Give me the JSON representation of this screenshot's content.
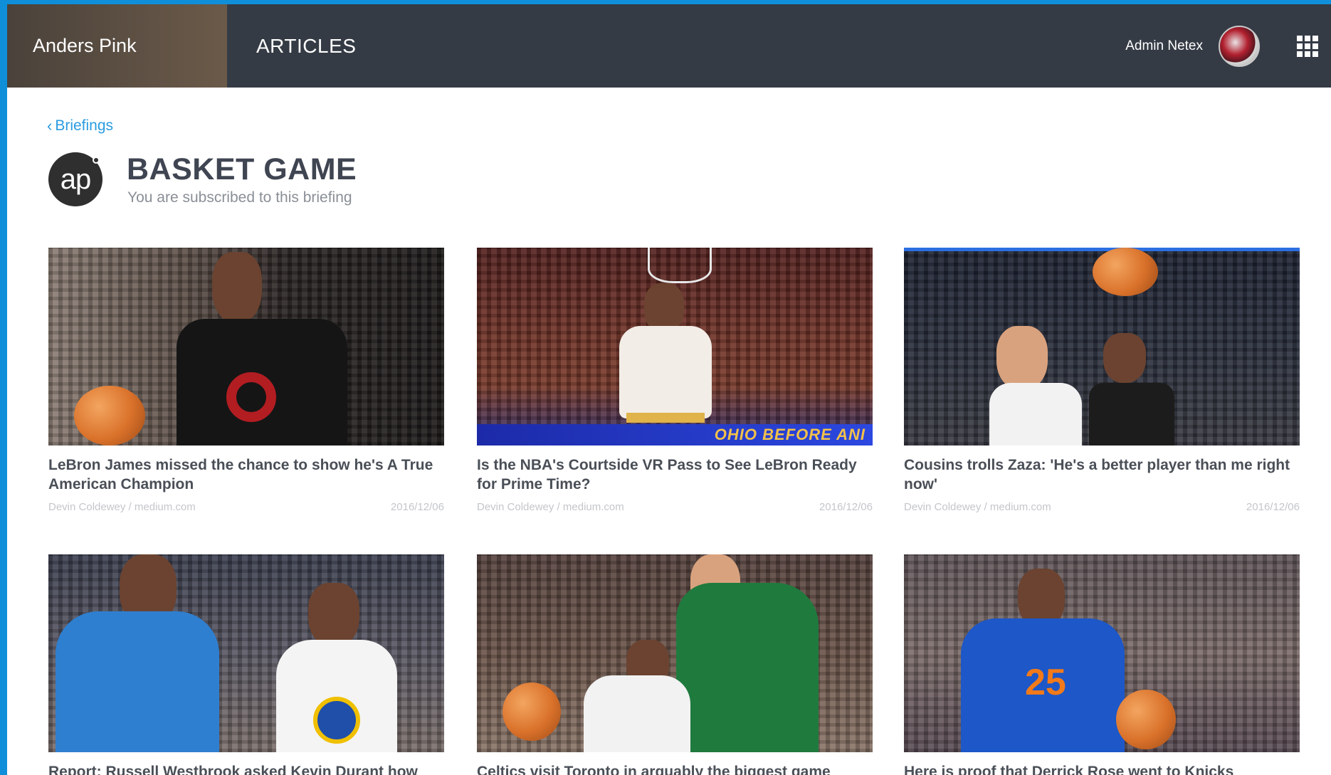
{
  "nav": {
    "brand": "Anders Pink",
    "section": "ARTICLES",
    "user_name": "Admin Netex"
  },
  "breadcrumb": {
    "label": "Briefings"
  },
  "briefing": {
    "logo_text": "ap",
    "title": "BASKET GAME",
    "subtitle": "You are subscribed to this briefing"
  },
  "articles": [
    {
      "title": "LeBron James missed the chance to show he's A True American Champion",
      "source": "Devin Coldewey  / medium.com",
      "date": "2016/12/06"
    },
    {
      "title": "Is the NBA's Courtside VR Pass to See LeBron Ready for Prime Time?",
      "source": "Devin Coldewey  / medium.com",
      "date": "2016/12/06",
      "banner_text": "OHIO  BEFORE ANI"
    },
    {
      "title": "Cousins trolls Zaza: 'He's a better player than me right now'",
      "source": "Devin Coldewey  / medium.com",
      "date": "2016/12/06"
    },
    {
      "title": "Report: Russell Westbrook asked Kevin Durant how"
    },
    {
      "title": "Celtics visit Toronto in arguably the biggest game"
    },
    {
      "title": "Here is proof that Derrick Rose went to Knicks"
    }
  ],
  "colors": {
    "accent": "#2a9be0",
    "topbar": "#353b45",
    "frame": "#0f8fd9"
  }
}
